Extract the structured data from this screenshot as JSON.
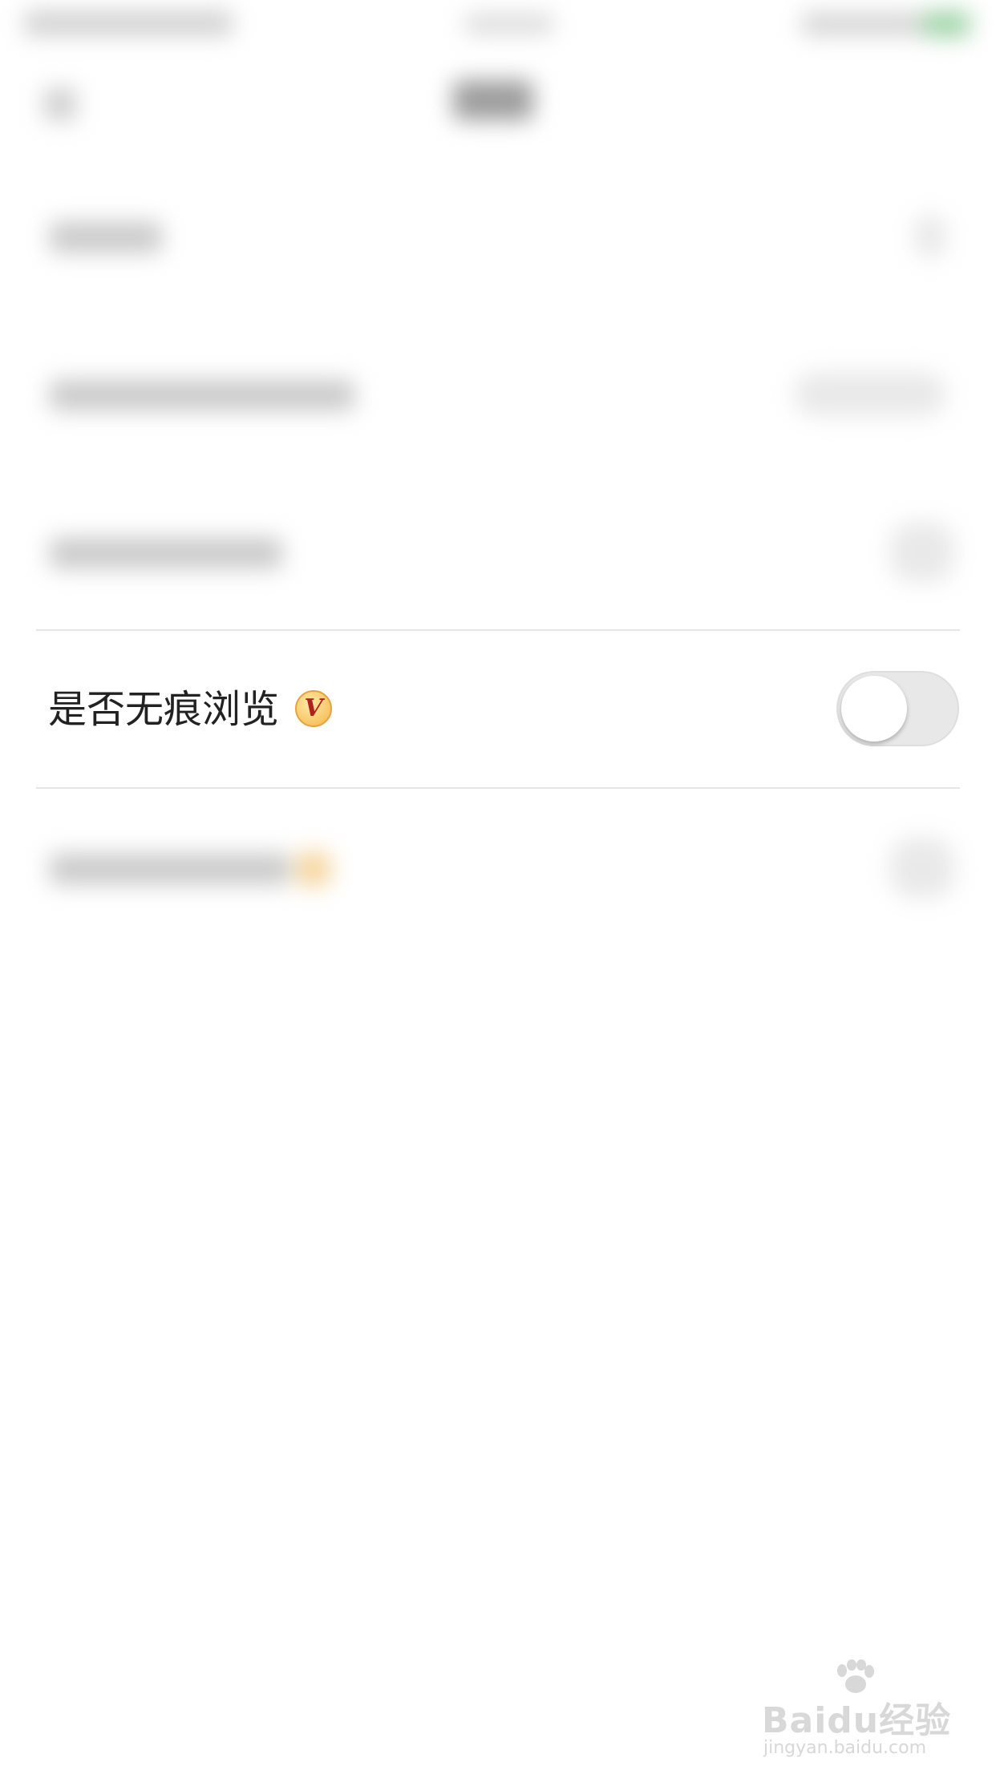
{
  "settings": {
    "incognito": {
      "label": "是否无痕浏览",
      "badge_letter": "V",
      "enabled": false
    }
  },
  "watermark": {
    "main": "Baidu经验",
    "sub": "jingyan.baidu.com"
  },
  "colors": {
    "toggle_off_track": "#e8e8e8",
    "badge_fill": "#f7c664",
    "badge_letter": "#b1201b",
    "text": "#222222"
  }
}
